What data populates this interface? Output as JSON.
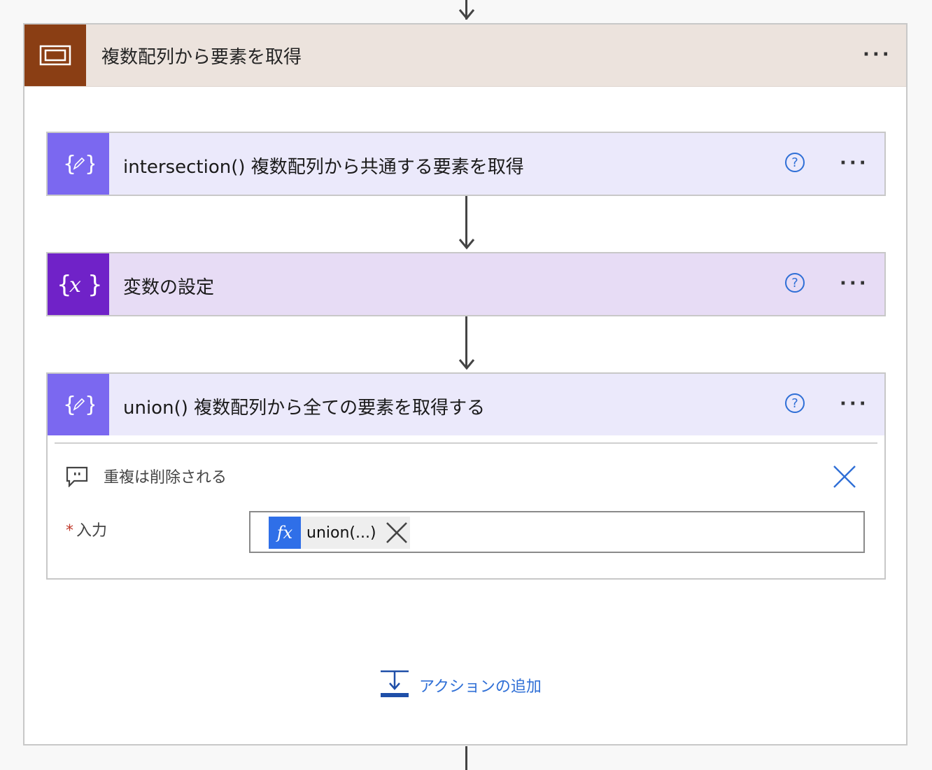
{
  "scope": {
    "title": "複数配列から要素を取得",
    "icon": "scope-icon",
    "more": "···",
    "color": "#8a3e14"
  },
  "actions": [
    {
      "title": "intersection() 複数配列から共通する要素を取得",
      "icon": "compose-icon",
      "help": "?",
      "more": "···",
      "header_color": "#ebe9fb",
      "icon_color": "#7b68f0"
    },
    {
      "title": "変数の設定",
      "icon": "variable-icon",
      "help": "?",
      "more": "···",
      "header_color": "#e7dcf5",
      "icon_color": "#7022c8"
    },
    {
      "title": "union() 複数配列から全ての要素を取得する",
      "icon": "compose-icon",
      "help": "?",
      "more": "···",
      "header_color": "#ebe9fb",
      "icon_color": "#7b68f0",
      "comment": "重複は削除される",
      "input_label": "入力",
      "required_mark": "*",
      "token_fx": "fx",
      "token_label": "union(...)"
    }
  ],
  "add_action": {
    "label": "アクションの追加"
  }
}
